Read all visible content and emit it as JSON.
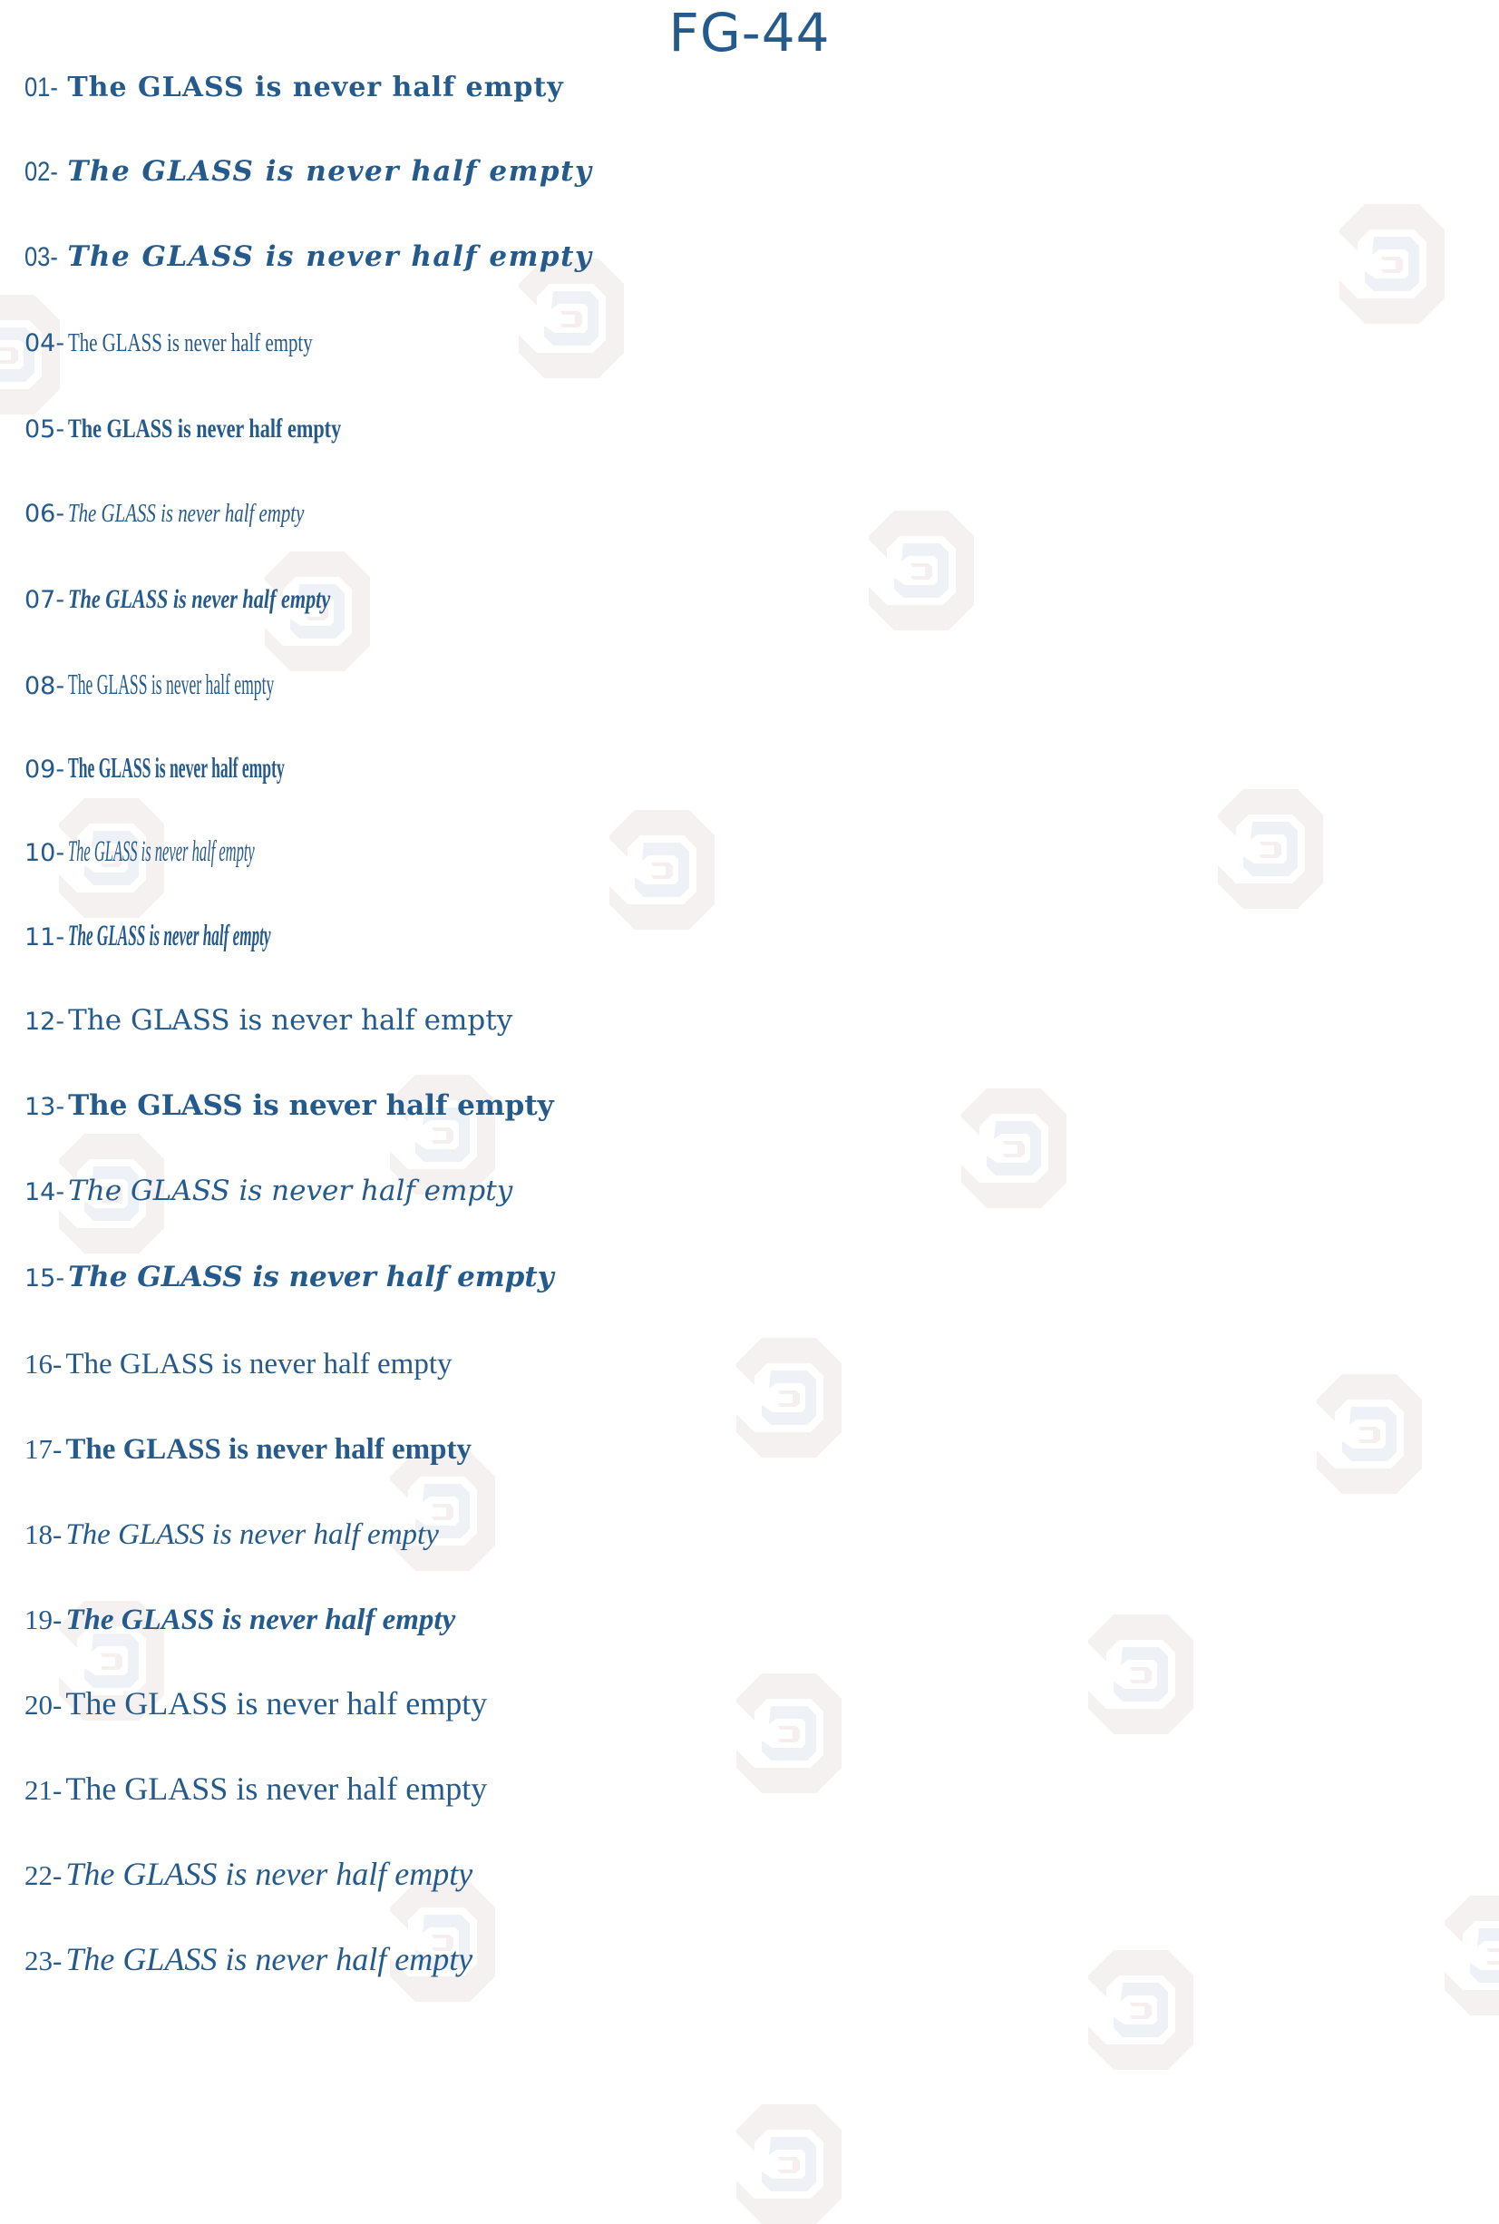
{
  "page": {
    "title": "FG-44",
    "accent_color": "#245a8c",
    "watermark_icon": "octagon-spiral-logo-icon"
  },
  "samples": [
    {
      "number": "01-",
      "text": "The GLASS is never half empty",
      "style": "black"
    },
    {
      "number": "02-",
      "text": "The GLASS is never half empty",
      "style": "black-italic"
    },
    {
      "number": "03-",
      "text": "The GLASS is never half empty",
      "style": "black-italic"
    },
    {
      "number": "04-",
      "text": "The GLASS is never half empty",
      "style": "condensed"
    },
    {
      "number": "05-",
      "text": "The GLASS is never half empty",
      "style": "condensed-bold"
    },
    {
      "number": "06-",
      "text": "The GLASS is never half empty",
      "style": "condensed-italic"
    },
    {
      "number": "07-",
      "text": "The GLASS is never half empty",
      "style": "condensed-bold-italic"
    },
    {
      "number": "08-",
      "text": "The GLASS is never half empty",
      "style": "extra-condensed"
    },
    {
      "number": "09-",
      "text": "The GLASS is never half empty",
      "style": "extra-condensed-bold"
    },
    {
      "number": "10-",
      "text": "The GLASS is never half empty",
      "style": "extra-condensed-italic"
    },
    {
      "number": "11-",
      "text": "The GLASS is never half empty",
      "style": "extra-condensed-bold-italic"
    },
    {
      "number": "12-",
      "text": "The GLASS is never half empty",
      "style": "regular"
    },
    {
      "number": "13-",
      "text": "The GLASS is never half empty",
      "style": "bold"
    },
    {
      "number": "14-",
      "text": "The GLASS is never half empty",
      "style": "italic"
    },
    {
      "number": "15-",
      "text": "The GLASS is never half empty",
      "style": "bold-italic"
    },
    {
      "number": "16-",
      "text": "The GLASS is never half empty",
      "style": "regular"
    },
    {
      "number": "17-",
      "text": "The GLASS is never half empty",
      "style": "bold"
    },
    {
      "number": "18-",
      "text": "The GLASS is never half empty",
      "style": "italic"
    },
    {
      "number": "19-",
      "text": "The GLASS is never half empty",
      "style": "bold-italic"
    },
    {
      "number": "20-",
      "text": "The GLASS is never half empty",
      "style": "regular"
    },
    {
      "number": "21-",
      "text": "The GLASS is never half empty",
      "style": "regular"
    },
    {
      "number": "22-",
      "text": "The GLASS is never half empty",
      "style": "italic"
    },
    {
      "number": "23-",
      "text": "The GLASS is never half empty",
      "style": "italic"
    }
  ]
}
